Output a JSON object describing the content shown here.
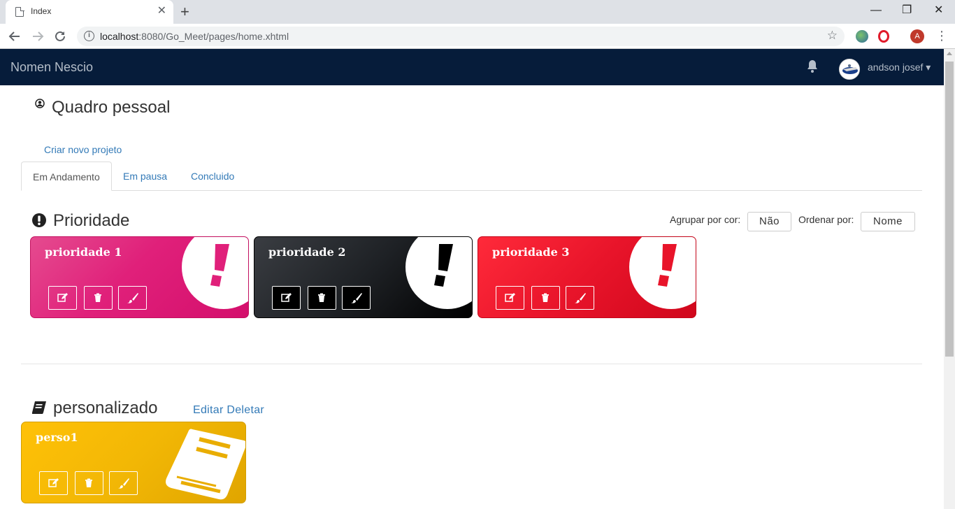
{
  "browser": {
    "tab_title": "Index",
    "tab_close": "✕",
    "new_tab": "+",
    "url_host": "localhost",
    "url_rest": ":8080/Go_Meet/pages/home.xhtml",
    "profile_initial": "A",
    "win_minimize": "—",
    "win_restore": "❐",
    "win_close": "✕"
  },
  "app": {
    "brand": "Nomen Nescio",
    "username": "andson josef",
    "caret": "▾"
  },
  "page": {
    "title": "Quadro pessoal",
    "create_link": "Criar novo projeto",
    "tabs": [
      "Em Andamento",
      "Em pausa",
      "Concluido"
    ]
  },
  "priority_section": {
    "title": "Prioridade",
    "group_label": "Agrupar por cor:",
    "group_value": "Não",
    "order_label": "Ordenar por:",
    "order_value": "Nome",
    "cards": [
      {
        "name": "prioridade 1",
        "color": "#e0207a"
      },
      {
        "name": "prioridade 2",
        "color": "#1e2125"
      },
      {
        "name": "prioridade 3",
        "color": "#e8142a"
      }
    ]
  },
  "custom_section": {
    "title": "personalizado",
    "actions": "Editar Deletar",
    "cards": [
      {
        "name": "perso1",
        "color": "#f2b705"
      }
    ]
  },
  "icons": {
    "card_actions": [
      "edit-icon",
      "trash-icon",
      "brush-icon"
    ]
  }
}
